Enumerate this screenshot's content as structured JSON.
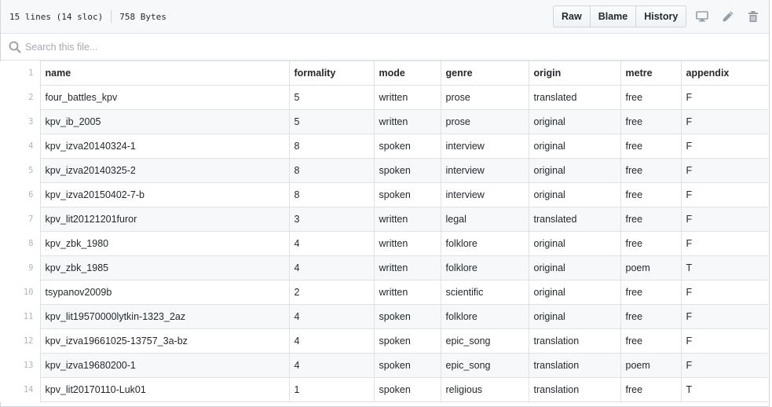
{
  "file_header": {
    "lines_info": "15 lines (14 sloc)",
    "size": "758 Bytes",
    "buttons": {
      "raw": "Raw",
      "blame": "Blame",
      "history": "History"
    },
    "icons": [
      "desktop-icon",
      "pencil-icon",
      "trash-icon"
    ]
  },
  "search": {
    "placeholder": "Search this file..."
  },
  "table": {
    "header_line": "1",
    "columns": [
      "name",
      "formality",
      "mode",
      "genre",
      "origin",
      "metre",
      "appendix"
    ],
    "rows": [
      {
        "line": "2",
        "cells": [
          "four_battles_kpv",
          "5",
          "written",
          "prose",
          "translated",
          "free",
          "F"
        ]
      },
      {
        "line": "3",
        "cells": [
          "kpv_ib_2005",
          "5",
          "written",
          "prose",
          "original",
          "free",
          "F"
        ]
      },
      {
        "line": "4",
        "cells": [
          "kpv_izva20140324-1",
          "8",
          "spoken",
          "interview",
          "original",
          "free",
          "F"
        ]
      },
      {
        "line": "5",
        "cells": [
          "kpv_izva20140325-2",
          "8",
          "spoken",
          "interview",
          "original",
          "free",
          "F"
        ]
      },
      {
        "line": "6",
        "cells": [
          "kpv_izva20150402-7-b",
          "8",
          "spoken",
          "interview",
          "original",
          "free",
          "F"
        ]
      },
      {
        "line": "7",
        "cells": [
          "kpv_lit20121201furor",
          "3",
          "written",
          "legal",
          "translated",
          "free",
          "F"
        ]
      },
      {
        "line": "8",
        "cells": [
          "kpv_zbk_1980",
          "4",
          "written",
          "folklore",
          "original",
          "free",
          "F"
        ]
      },
      {
        "line": "9",
        "cells": [
          "kpv_zbk_1985",
          "4",
          "written",
          "folklore",
          "original",
          "poem",
          "T"
        ]
      },
      {
        "line": "10",
        "cells": [
          "tsypanov2009b",
          "2",
          "written",
          "scientific",
          "original",
          "free",
          "F"
        ]
      },
      {
        "line": "11",
        "cells": [
          "kpv_lit19570000lytkin-1323_2az",
          "4",
          "spoken",
          "folklore",
          "original",
          "free",
          "F"
        ]
      },
      {
        "line": "12",
        "cells": [
          "kpv_izva19661025-13757_3a-bz",
          "4",
          "spoken",
          "epic_song",
          "translation",
          "free",
          "F"
        ]
      },
      {
        "line": "13",
        "cells": [
          "kpv_izva19680200-1",
          "4",
          "spoken",
          "epic_song",
          "translation",
          "poem",
          "F"
        ]
      },
      {
        "line": "14",
        "cells": [
          "kpv_lit20170110-Luk01",
          "1",
          "spoken",
          "religious",
          "translation",
          "free",
          "T"
        ]
      }
    ]
  },
  "colors": {
    "border": "#d1d5da",
    "header_bg": "#f6f8fa",
    "alt_row_bg": "#f6f8fa",
    "line_number": "#b0b5ba",
    "icon": "#959da5"
  }
}
